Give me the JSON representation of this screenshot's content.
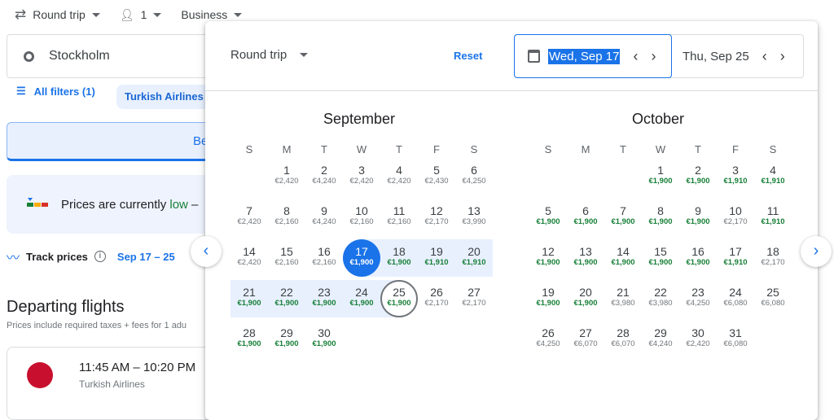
{
  "topbar": {
    "trip_type": "Round trip",
    "passengers": "1",
    "cabin": "Business"
  },
  "origin": {
    "value": "Stockholm"
  },
  "filters": {
    "all_filters": "All filters (1)",
    "airline_chip": "Turkish Airlines"
  },
  "best_tab": "Be",
  "insight": {
    "text": "Prices are currently ",
    "level": "low",
    "suffix": " –"
  },
  "track": {
    "label": "Track prices",
    "dates": "Sep 17 – 25"
  },
  "departing": {
    "title": "Departing flights",
    "subtitle": "Prices include required taxes + fees for 1 adu"
  },
  "flight": {
    "times": "11:45 AM – 10:20 PM",
    "airline": "Turkish Airlines"
  },
  "picker": {
    "trip_type": "Round trip",
    "reset": "Reset",
    "departure": "Wed, Sep 17",
    "return": "Thu, Sep 25",
    "selected_start": {
      "month": 0,
      "day": 17
    },
    "selected_end": {
      "month": 0,
      "day": 25
    },
    "weekdays": [
      "S",
      "M",
      "T",
      "W",
      "T",
      "F",
      "S"
    ],
    "colors": {
      "accent": "#1a73e8",
      "low_price": "#188038",
      "range": "#e8f0fe"
    },
    "months": [
      {
        "name": "September",
        "offset": 1,
        "days": [
          [
            "€2,420",
            0
          ],
          [
            "€4,240",
            0
          ],
          [
            "€2,420",
            0
          ],
          [
            "€2,420",
            0
          ],
          [
            "€2,430",
            0
          ],
          [
            "€4,250",
            0
          ],
          [
            "€2,420",
            0
          ],
          [
            "€2,160",
            0
          ],
          [
            "€4,240",
            0
          ],
          [
            "€2,160",
            0
          ],
          [
            "€2,160",
            0
          ],
          [
            "€2,170",
            0
          ],
          [
            "€3,990",
            0
          ],
          [
            "€2,420",
            0
          ],
          [
            "€2,160",
            0
          ],
          [
            "€2,160",
            0
          ],
          [
            "€1,900",
            1
          ],
          [
            "€1,900",
            1
          ],
          [
            "€1,910",
            1
          ],
          [
            "€1,910",
            1
          ],
          [
            "€1,900",
            1
          ],
          [
            "€1,900",
            1
          ],
          [
            "€1,900",
            1
          ],
          [
            "€1,900",
            1
          ],
          [
            "€1,900",
            1
          ],
          [
            "€2,170",
            0
          ],
          [
            "€2,170",
            0
          ],
          [
            "€1,900",
            1
          ],
          [
            "€1,900",
            1
          ],
          [
            "€1,900",
            1
          ]
        ]
      },
      {
        "name": "October",
        "offset": 3,
        "days": [
          [
            "€1,900",
            1
          ],
          [
            "€1,900",
            1
          ],
          [
            "€1,910",
            1
          ],
          [
            "€1,910",
            1
          ],
          [
            "€1,900",
            1
          ],
          [
            "€1,900",
            1
          ],
          [
            "€1,900",
            1
          ],
          [
            "€1,900",
            1
          ],
          [
            "€1,900",
            1
          ],
          [
            "€2,170",
            0
          ],
          [
            "€1,910",
            1
          ],
          [
            "€1,900",
            1
          ],
          [
            "€1,900",
            1
          ],
          [
            "€1,900",
            1
          ],
          [
            "€1,900",
            1
          ],
          [
            "€1,900",
            1
          ],
          [
            "€1,910",
            1
          ],
          [
            "€2,170",
            0
          ],
          [
            "€1,900",
            1
          ],
          [
            "€1,900",
            1
          ],
          [
            "€3,980",
            0
          ],
          [
            "€3,980",
            0
          ],
          [
            "€4,250",
            0
          ],
          [
            "€6,080",
            0
          ],
          [
            "€6,080",
            0
          ],
          [
            "€4,250",
            0
          ],
          [
            "€6,070",
            0
          ],
          [
            "€6,070",
            0
          ],
          [
            "€4,240",
            0
          ],
          [
            "€2,420",
            0
          ],
          [
            "€6,080",
            0
          ]
        ]
      }
    ]
  }
}
